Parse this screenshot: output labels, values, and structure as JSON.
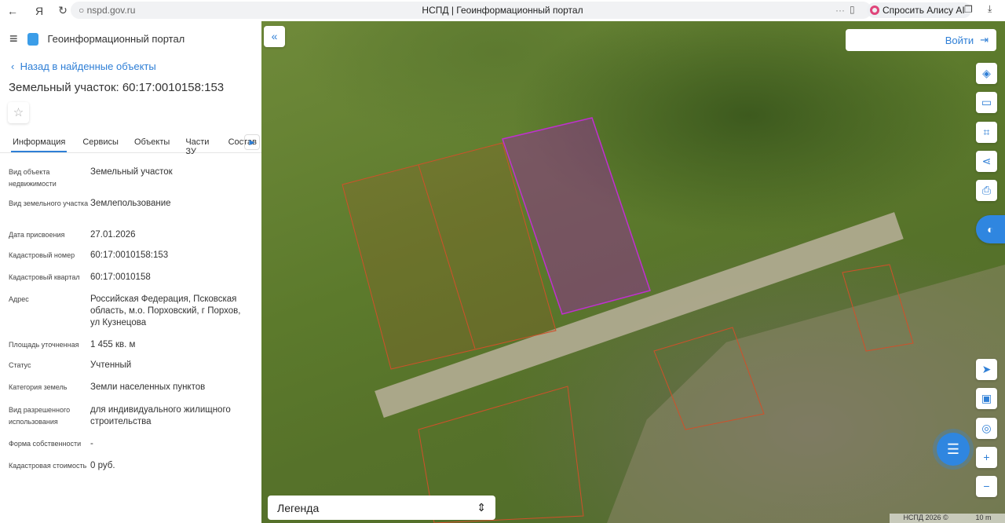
{
  "browser": {
    "url": "nspd.gov.ru",
    "title": "НСПД | Геоинформационный портал",
    "alice": "Спросить Алису AI"
  },
  "header": {
    "app_title": "Геоинформационный портал"
  },
  "panel": {
    "back": "Назад в найденные объекты",
    "title": "Земельный участок: 60:17:0010158:153",
    "tabs": [
      "Информация",
      "Сервисы",
      "Объекты",
      "Части ЗУ",
      "Состав"
    ],
    "fields": [
      {
        "label": "Вид объекта недвижимости",
        "value": "Земельный участок"
      },
      {
        "label": "Вид земельного участка",
        "value": "Землепользование"
      },
      {
        "label": "Дата присвоения",
        "value": "27.01.2026"
      },
      {
        "label": "Кадастровый номер",
        "value": "60:17:0010158:153"
      },
      {
        "label": "Кадастровый квартал",
        "value": "60:17:0010158"
      },
      {
        "label": "Адрес",
        "value": "Российская Федерация, Псковская область, м.о. Порховский, г Порхов, ул Кузнецова"
      },
      {
        "label": "Площадь уточненная",
        "value": "1 455 кв. м"
      },
      {
        "label": "Статус",
        "value": "Учтенный"
      },
      {
        "label": "Категория земель",
        "value": "Земли населенных пунктов"
      },
      {
        "label": "Вид разрешенного использования",
        "value": "для индивидуального жилищного строительства"
      },
      {
        "label": "Форма собственности",
        "value": "-"
      },
      {
        "label": "Кадастровая стоимость",
        "value": "0 руб."
      }
    ]
  },
  "map": {
    "login": "Войти",
    "legend": "Легенда",
    "copyright": "НСПД 2026 ©",
    "scale": "10 m"
  }
}
